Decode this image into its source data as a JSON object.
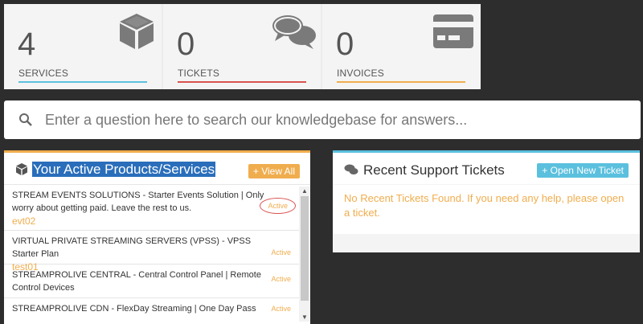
{
  "stats": [
    {
      "count": "4",
      "label": "SERVICES",
      "color": "#5bc0de",
      "icon": "cube-icon"
    },
    {
      "count": "0",
      "label": "TICKETS",
      "color": "#d9534f",
      "icon": "comments-icon"
    },
    {
      "count": "0",
      "label": "INVOICES",
      "color": "#f0ad4e",
      "icon": "credit-card-icon"
    }
  ],
  "search": {
    "placeholder": "Enter a question here to search our knowledgebase for answers..."
  },
  "products": {
    "title": "Your Active Products/Services",
    "view_all": "View All",
    "items": [
      {
        "name": "STREAM EVENTS SOLUTIONS - Starter Events Solution | Only worry about getting paid. Leave the rest to us.",
        "domain": "evt02",
        "status": "Active"
      },
      {
        "name": "VIRTUAL PRIVATE STREAMING SERVERS (VPSS) - VPSS Starter Plan",
        "domain": "test01",
        "status": "Active"
      },
      {
        "name": "STREAMPROLIVE CENTRAL - Central Control Panel | Remote Control Devices",
        "domain": "",
        "status": "Active"
      },
      {
        "name": "STREAMPROLIVE CDN - FlexDay Streaming | One Day Pass",
        "domain": "",
        "status": "Active"
      }
    ]
  },
  "tickets": {
    "title": "Recent Support Tickets",
    "open_new": "Open New Ticket",
    "empty_message": "No Recent Tickets Found. If you need any help, please open a ticket."
  }
}
